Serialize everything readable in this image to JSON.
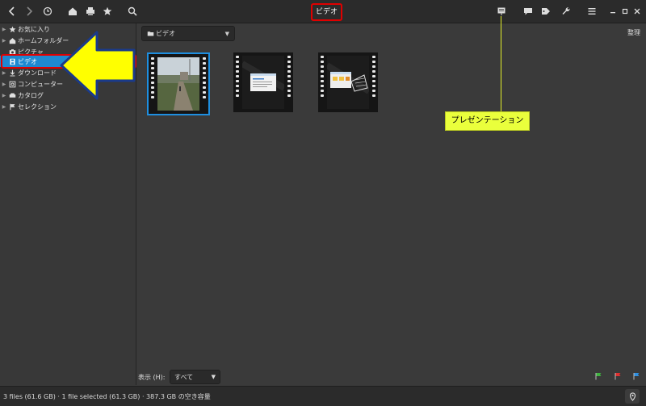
{
  "header": {
    "title": "ビデオ"
  },
  "sidebar": {
    "items": [
      {
        "label": "お気に入り"
      },
      {
        "label": "ホームフォルダー"
      },
      {
        "label": "ピクチャ"
      },
      {
        "label": "ビデオ"
      },
      {
        "label": "ダウンロード"
      },
      {
        "label": "コンピューター"
      },
      {
        "label": "カタログ"
      },
      {
        "label": "セレクション"
      }
    ]
  },
  "toolbar": {
    "location": "ビデオ",
    "organize": "整理"
  },
  "filter": {
    "label": "表示 (H):",
    "value": "すべて"
  },
  "status": {
    "text": "3 files (61.6 GB)  ·  1 file selected (61.3 GB)  ·  387.3 GB の空き容量"
  },
  "annotation": {
    "callout": "プレゼンテーション"
  },
  "colors": {
    "accent": "#1d89d1",
    "highlight_red": "#e00000",
    "callout_yellow": "#eaff3c",
    "arrow_yellow": "#ffff00",
    "flag_green": "#3fb33f",
    "flag_red": "#e03030",
    "flag_blue": "#2f8fe0"
  }
}
